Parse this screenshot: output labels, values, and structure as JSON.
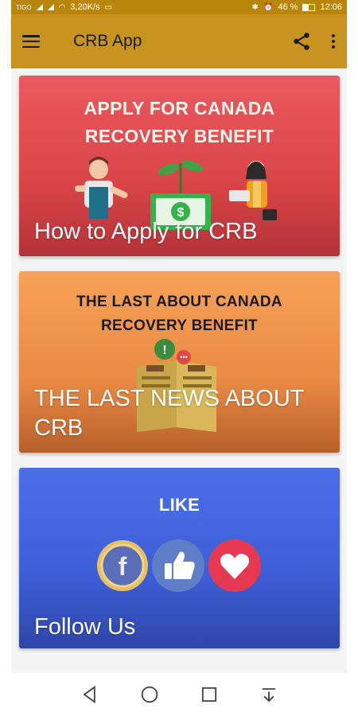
{
  "status_bar": {
    "carrier": "TIGO",
    "speed": "3,20K/s",
    "battery": "46 %",
    "time": "12:06"
  },
  "app_bar": {
    "title": "CRB App",
    "icons": [
      "menu-icon",
      "share-icon",
      "more-vert-icon"
    ],
    "color": "#c8941f"
  },
  "cards": [
    {
      "heading_line1": "APPLY FOR CANADA",
      "heading_line2": "RECOVERY BENEFIT",
      "caption": "How to Apply for CRB",
      "color": "#e0484d"
    },
    {
      "heading_line1": "THE LAST ABOUT CANADA",
      "heading_line2": "RECOVERY BENEFIT",
      "caption_line1": "THE LAST NEWS ABOUT",
      "caption_line2": "CRB",
      "color": "#f29350"
    },
    {
      "heading_line1": "LIKE",
      "caption": "Follow Us",
      "color": "#4565dd"
    }
  ],
  "nav_bar": {
    "icons": [
      "back-icon",
      "home-icon",
      "recents-icon",
      "notification-pull-icon"
    ]
  }
}
